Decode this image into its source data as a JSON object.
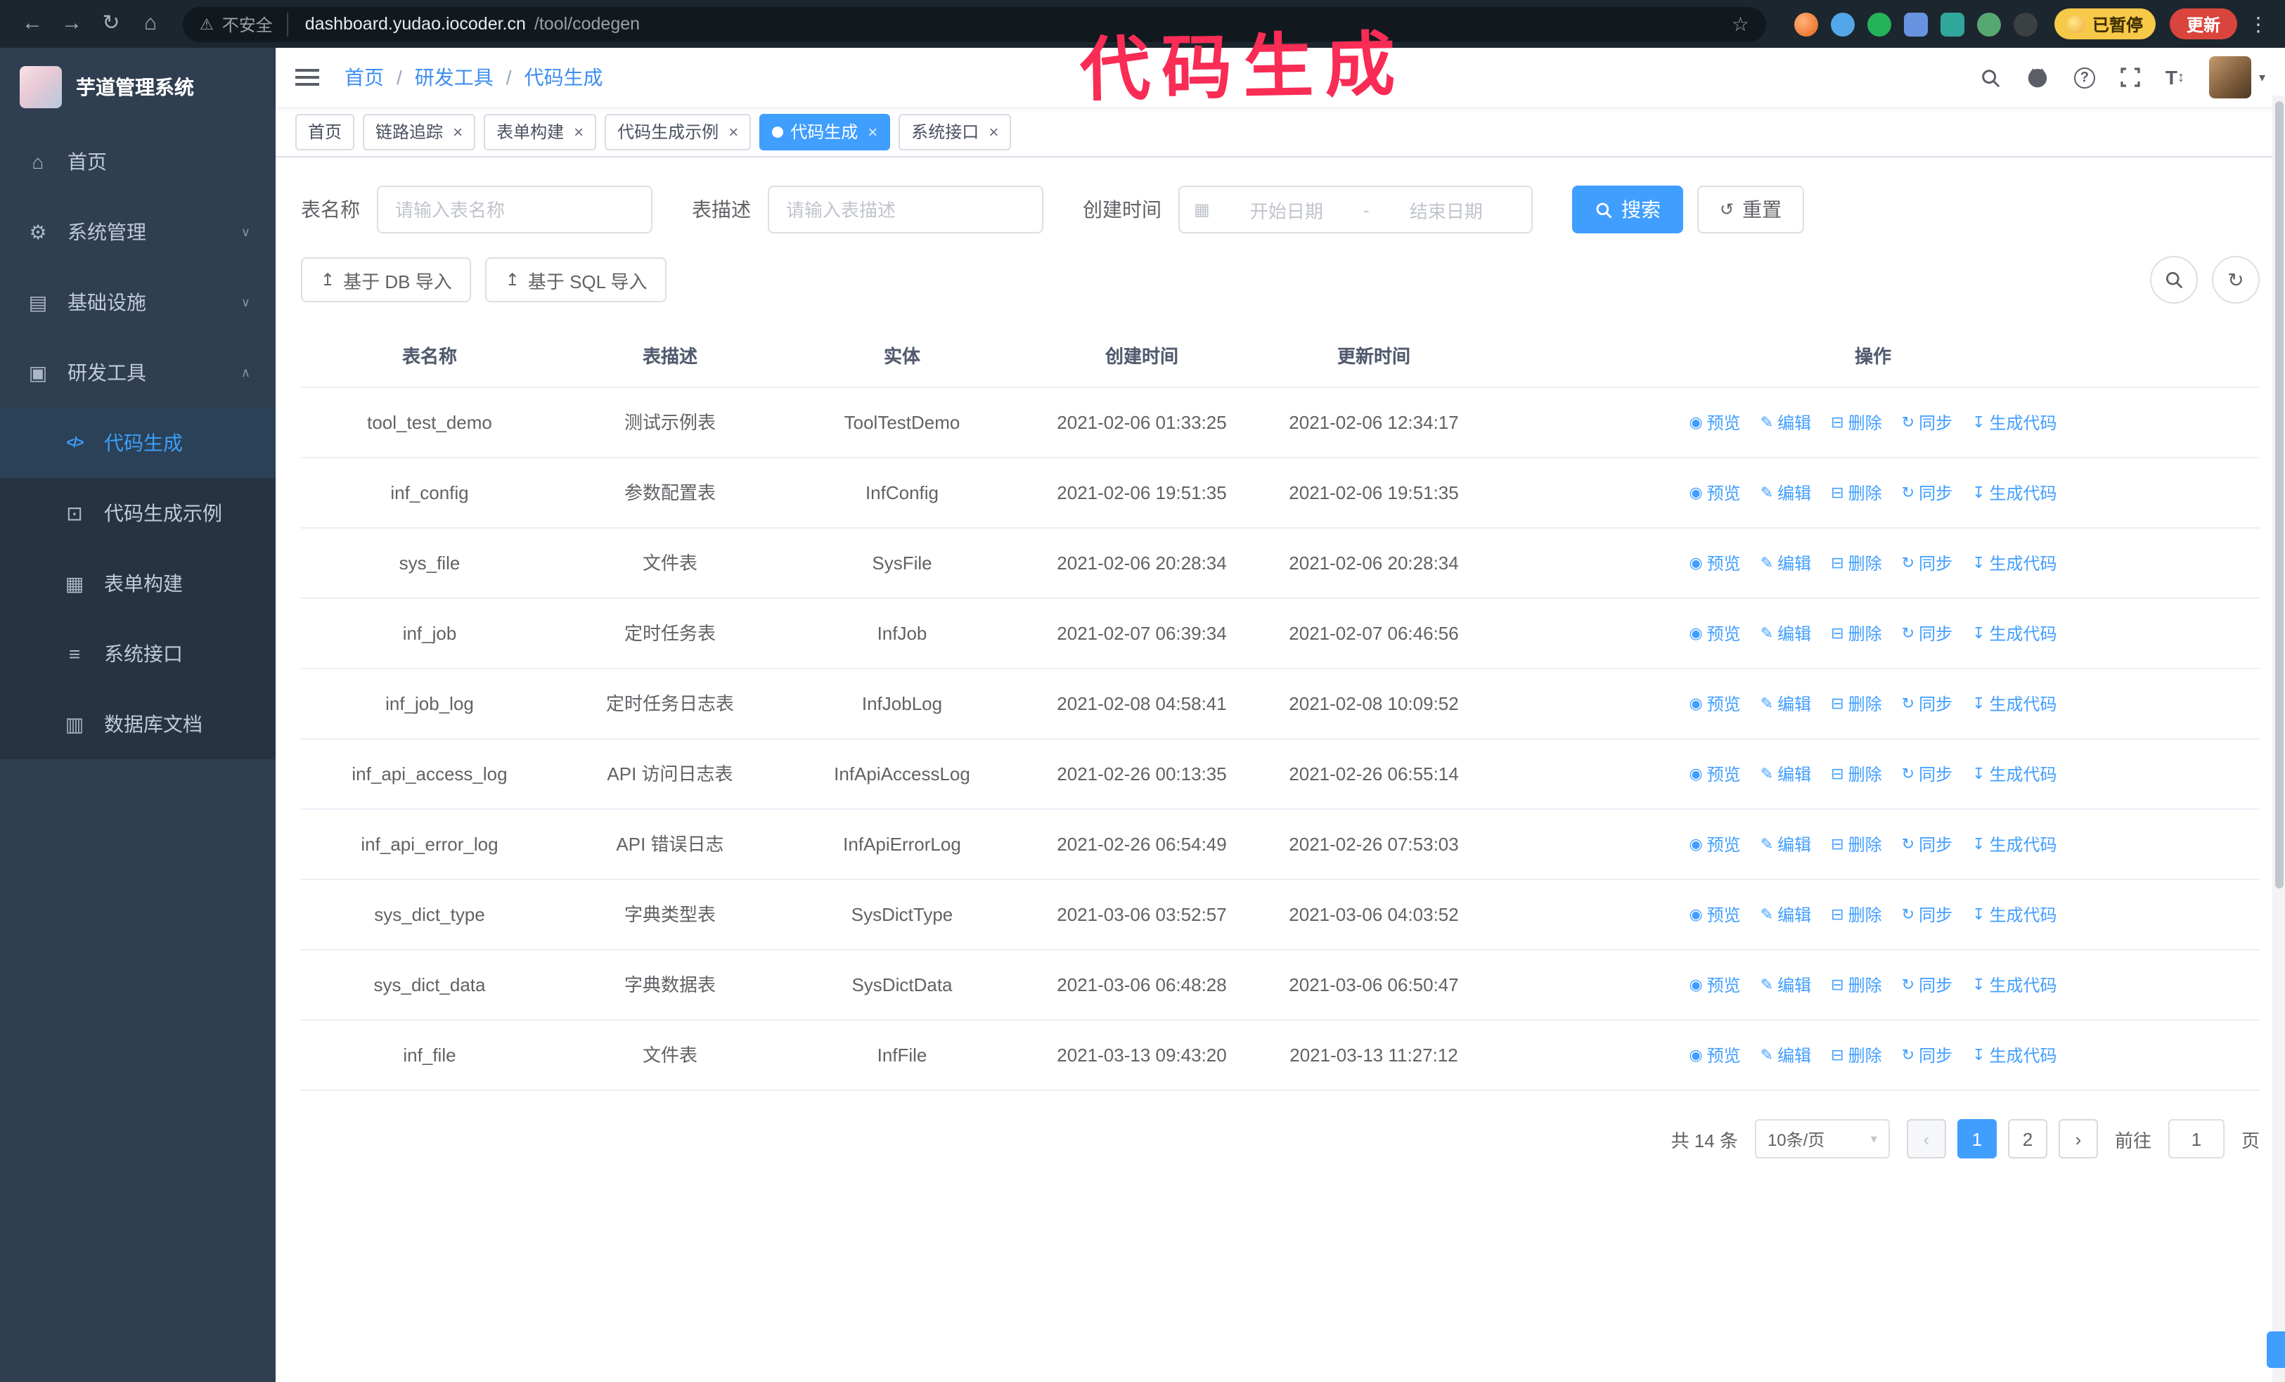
{
  "colors": {
    "accent": "#409EFF",
    "annotation": "#F92C55",
    "update_button_bg": "#D9453C",
    "paused_badge_bg": "#F7C948",
    "sidebar_bg": "#2F3E50",
    "submenu_bg": "#253342"
  },
  "annotation": {
    "text": "代码生成"
  },
  "browser": {
    "insecure_label": "不安全",
    "url_host": "dashboard.yudao.iocoder.cn",
    "url_path": "/tool/codegen",
    "paused_badge": "已暂停",
    "update_button": "更新"
  },
  "sidebar": {
    "logo_title": "芋道管理系统",
    "items": [
      {
        "label": "首页"
      },
      {
        "label": "系统管理"
      },
      {
        "label": "基础设施"
      },
      {
        "label": "研发工具"
      }
    ],
    "subitems": [
      {
        "label": "代码生成"
      },
      {
        "label": "代码生成示例"
      },
      {
        "label": "表单构建"
      },
      {
        "label": "系统接口"
      },
      {
        "label": "数据库文档"
      }
    ]
  },
  "header": {
    "breadcrumb": [
      "首页",
      "研发工具",
      "代码生成"
    ],
    "separator": "/"
  },
  "tabs": [
    {
      "label": "首页"
    },
    {
      "label": "链路追踪"
    },
    {
      "label": "表单构建"
    },
    {
      "label": "代码生成示例"
    },
    {
      "label": "代码生成"
    },
    {
      "label": "系统接口"
    }
  ],
  "filters": {
    "table_name_label": "表名称",
    "table_name_placeholder": "请输入表名称",
    "table_desc_label": "表描述",
    "table_desc_placeholder": "请输入表描述",
    "create_time_label": "创建时间",
    "start_placeholder": "开始日期",
    "range_separator": "-",
    "end_placeholder": "结束日期",
    "search_button": "搜索",
    "reset_button": "重置"
  },
  "toolbar": {
    "import_db_button": "基于 DB 导入",
    "import_sql_button": "基于 SQL 导入"
  },
  "table": {
    "columns": [
      "表名称",
      "表描述",
      "实体",
      "创建时间",
      "更新时间",
      "操作"
    ],
    "actions": [
      "预览",
      "编辑",
      "删除",
      "同步",
      "生成代码"
    ],
    "rows": [
      {
        "name": "tool_test_demo",
        "desc": "测试示例表",
        "entity": "ToolTestDemo",
        "created": "2021-02-06 01:33:25",
        "updated": "2021-02-06 12:34:17"
      },
      {
        "name": "inf_config",
        "desc": "参数配置表",
        "entity": "InfConfig",
        "created": "2021-02-06 19:51:35",
        "updated": "2021-02-06 19:51:35"
      },
      {
        "name": "sys_file",
        "desc": "文件表",
        "entity": "SysFile",
        "created": "2021-02-06 20:28:34",
        "updated": "2021-02-06 20:28:34"
      },
      {
        "name": "inf_job",
        "desc": "定时任务表",
        "entity": "InfJob",
        "created": "2021-02-07 06:39:34",
        "updated": "2021-02-07 06:46:56"
      },
      {
        "name": "inf_job_log",
        "desc": "定时任务日志表",
        "entity": "InfJobLog",
        "created": "2021-02-08 04:58:41",
        "updated": "2021-02-08 10:09:52"
      },
      {
        "name": "inf_api_access_log",
        "desc": "API 访问日志表",
        "entity": "InfApiAccessLog",
        "created": "2021-02-26 00:13:35",
        "updated": "2021-02-26 06:55:14"
      },
      {
        "name": "inf_api_error_log",
        "desc": "API 错误日志",
        "entity": "InfApiErrorLog",
        "created": "2021-02-26 06:54:49",
        "updated": "2021-02-26 07:53:03"
      },
      {
        "name": "sys_dict_type",
        "desc": "字典类型表",
        "entity": "SysDictType",
        "created": "2021-03-06 03:52:57",
        "updated": "2021-03-06 04:03:52"
      },
      {
        "name": "sys_dict_data",
        "desc": "字典数据表",
        "entity": "SysDictData",
        "created": "2021-03-06 06:48:28",
        "updated": "2021-03-06 06:50:47"
      },
      {
        "name": "inf_file",
        "desc": "文件表",
        "entity": "InfFile",
        "created": "2021-03-13 09:43:20",
        "updated": "2021-03-13 11:27:12"
      }
    ]
  },
  "pagination": {
    "total_label": "共 14 条",
    "page_size_label": "10条/页",
    "pages": [
      "1",
      "2"
    ],
    "goto_label": "前往",
    "goto_value": "1",
    "unit_label": "页"
  },
  "icons": {
    "back": "←",
    "forward": "→",
    "reload": "↻",
    "home": "⌂",
    "warning": "⚠",
    "star": "☆",
    "kebab": "⋮",
    "close": "×",
    "caret_down": "▾",
    "chevron_down": "∨",
    "chevron_up": "∧",
    "calendar": "▦",
    "upload": "↥",
    "refresh": "↻",
    "reset": "↺",
    "eye": "◉",
    "edit": "✎",
    "delete": "⊟",
    "sync": "↻",
    "download": "↧",
    "question": "?",
    "font_size": "T",
    "updown": "↕",
    "menu_home": "⌂",
    "menu_system": "⚙",
    "menu_infra": "▤",
    "menu_dev": "▣",
    "menu_codegen": "</>",
    "menu_demo": "⊡",
    "menu_form": "▦",
    "menu_api": "≡",
    "menu_db": "▥",
    "prev": "‹",
    "next": "›"
  }
}
